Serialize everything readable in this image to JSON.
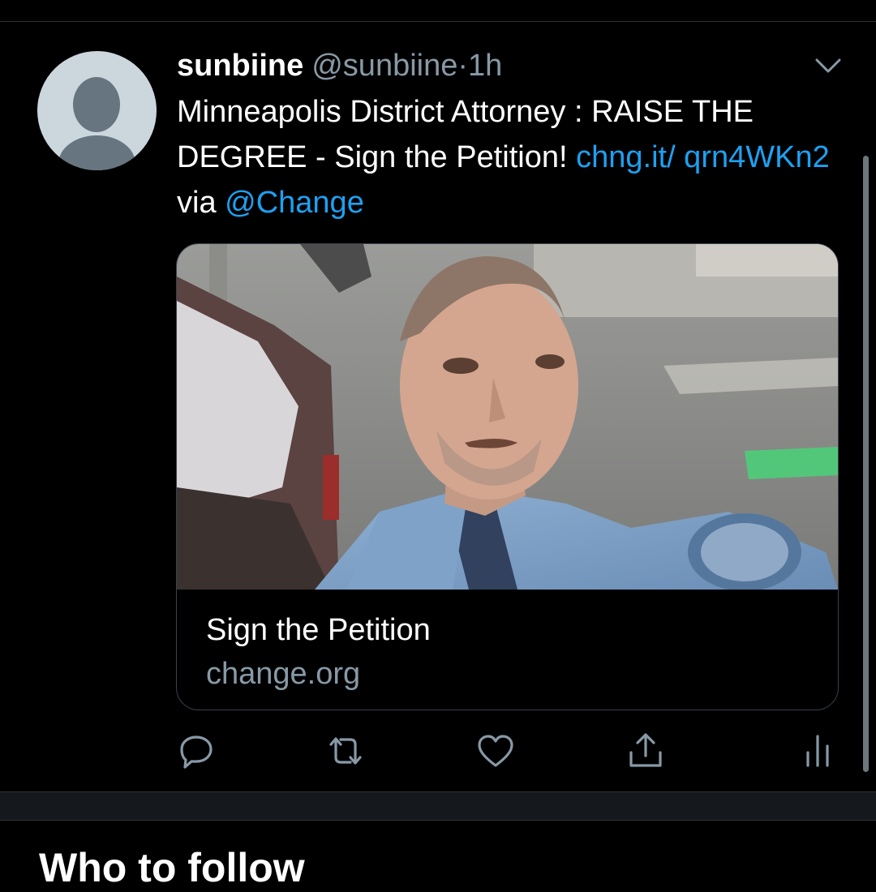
{
  "tweet": {
    "display_name": "sunbiine",
    "handle": "@sunbiine",
    "separator": "·",
    "time": "1h",
    "text_part1": "Minneapolis District Attorney : RAISE THE DEGREE - Sign the Petition! ",
    "link_url": "chng.it/ qrn4WKn2",
    "text_part2": " via ",
    "mention": "@Change"
  },
  "card": {
    "title": "Sign the Petition",
    "domain": "change.org",
    "image_name": "police-officer-photo"
  },
  "actions": {
    "icons": [
      "reply-icon",
      "retweet-icon",
      "like-icon",
      "share-icon",
      "analytics-icon"
    ]
  },
  "section": {
    "title": "Who to follow"
  },
  "colors": {
    "background": "#000000",
    "link": "#1da1f2",
    "secondary_text": "#8899a6",
    "divider": "#2f3336"
  }
}
